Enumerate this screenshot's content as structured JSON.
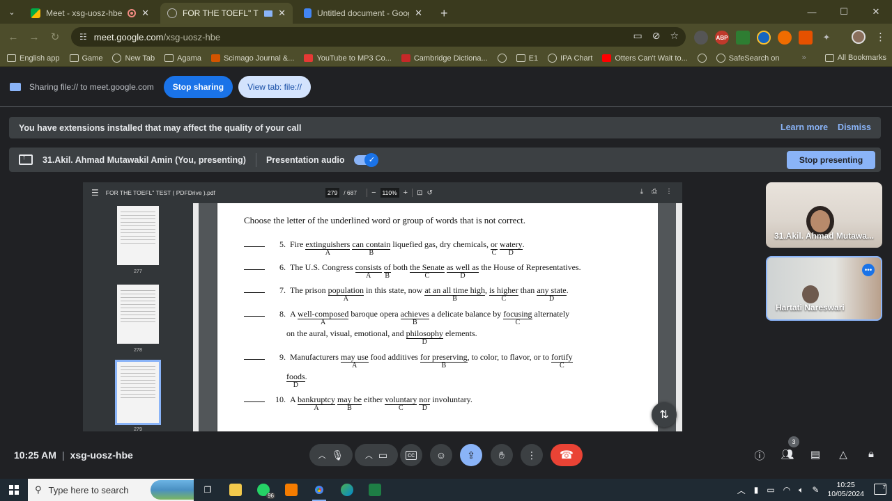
{
  "browser": {
    "tabs": [
      {
        "title": "Meet - xsg-uosz-hbe",
        "active": false,
        "recording": true
      },
      {
        "title": "FOR THE TOEFL\" TEST ( PDF",
        "active": true
      },
      {
        "title": "Untitled document - Google D",
        "active": false
      }
    ],
    "omnibox": {
      "host": "meet.google.com",
      "path": "/xsg-uosz-hbe"
    },
    "extensions": [
      "ABP"
    ],
    "bookmarks": [
      "English app",
      "Game",
      "New Tab",
      "Agama",
      "Scimago Journal &...",
      "YouTube to MP3 Co...",
      "Cambridge Dictiona...",
      "",
      "E1",
      "IPA Chart",
      "Otters Can't Wait to...",
      "",
      "SafeSearch on"
    ],
    "bookmarks_right": "All Bookmarks"
  },
  "sharebar": {
    "text": "Sharing file:// to meet.google.com",
    "stop_label": "Stop sharing",
    "view_label": "View tab: file://"
  },
  "notice": {
    "text": "You have extensions installed that may affect the quality of your call",
    "learn_more": "Learn more",
    "dismiss": "Dismiss"
  },
  "presenting": {
    "name": "31.Akil. Ahmad Mutawakil Amin (You, presenting)",
    "audio_label": "Presentation audio",
    "stop_label": "Stop presenting"
  },
  "pdf": {
    "filename": "FOR THE TOEFL\" TEST ( PDFDrive ).pdf",
    "page": "279",
    "total": "/ 687",
    "zoom": "110%",
    "thumb_numbers": [
      "277",
      "278",
      "279"
    ],
    "instruction": "Choose the letter of the underlined word or group of words that is not correct.",
    "questions": [
      {
        "num": "5.",
        "parts": [
          [
            "t",
            "Fire "
          ],
          [
            "u",
            "extinguishers",
            "A"
          ],
          [
            "t",
            " "
          ],
          [
            "u",
            "can contain",
            "B"
          ],
          [
            "t",
            " liquefied gas, dry chemicals, "
          ],
          [
            "u",
            "or",
            "C"
          ],
          [
            "t",
            " "
          ],
          [
            "u",
            "watery",
            "D"
          ],
          [
            "t",
            "."
          ]
        ]
      },
      {
        "num": "6.",
        "parts": [
          [
            "t",
            "The U.S. Congress "
          ],
          [
            "u",
            "consists",
            "A"
          ],
          [
            "t",
            " "
          ],
          [
            "u",
            "of",
            "B"
          ],
          [
            "t",
            " both "
          ],
          [
            "u",
            "the Senate",
            "C"
          ],
          [
            "t",
            " "
          ],
          [
            "u",
            "as well as",
            "D"
          ],
          [
            "t",
            " the House of Representatives."
          ]
        ]
      },
      {
        "num": "7.",
        "parts": [
          [
            "t",
            "The prison "
          ],
          [
            "u",
            "population",
            "A"
          ],
          [
            "t",
            " in this state, now "
          ],
          [
            "u",
            "at an all time high",
            "B"
          ],
          [
            "t",
            ", "
          ],
          [
            "u",
            "is higher",
            "C"
          ],
          [
            "t",
            " than "
          ],
          [
            "u",
            "any state",
            "D"
          ],
          [
            "t",
            "."
          ]
        ]
      },
      {
        "num": "8.",
        "parts": [
          [
            "t",
            "A "
          ],
          [
            "u",
            "well-composed",
            "A"
          ],
          [
            "t",
            " baroque opera "
          ],
          [
            "u",
            "achieves",
            "B"
          ],
          [
            "t",
            " a delicate balance by "
          ],
          [
            "u",
            "focusing",
            "C"
          ],
          [
            "t",
            " alternately"
          ]
        ],
        "cont": [
          [
            "t",
            "on the aural, visual, emotional, and "
          ],
          [
            "u",
            "philosophy",
            "D"
          ],
          [
            "t",
            " elements."
          ]
        ]
      },
      {
        "num": "9.",
        "parts": [
          [
            "t",
            "Manufacturers "
          ],
          [
            "u",
            "may use",
            "A"
          ],
          [
            "t",
            " food additives "
          ],
          [
            "u",
            "for preserving",
            "B"
          ],
          [
            "t",
            ", to color, to flavor, or to "
          ],
          [
            "u",
            "fortify",
            "C"
          ]
        ],
        "cont": [
          [
            "u",
            "foods",
            "D"
          ],
          [
            "t",
            "."
          ]
        ]
      },
      {
        "num": "10.",
        "parts": [
          [
            "t",
            "A "
          ],
          [
            "u",
            "bankruptcy",
            "A"
          ],
          [
            "t",
            " "
          ],
          [
            "u",
            "may be",
            "B"
          ],
          [
            "t",
            " either "
          ],
          [
            "u",
            "voluntary",
            "C"
          ],
          [
            "t",
            " "
          ],
          [
            "u",
            "nor",
            "D"
          ],
          [
            "t",
            " involuntary."
          ]
        ]
      }
    ]
  },
  "participants": [
    {
      "name": "31.Akil. Ahmad Mutawa..."
    },
    {
      "name": "Hartati Nareswari"
    }
  ],
  "meeting": {
    "time": "10:25 AM",
    "code": "xsg-uosz-hbe",
    "people_count": "3"
  },
  "taskbar": {
    "search_placeholder": "Type here to search",
    "whatsapp_badge": "96",
    "time": "10:25",
    "date": "10/05/2024",
    "notifications": "7"
  }
}
